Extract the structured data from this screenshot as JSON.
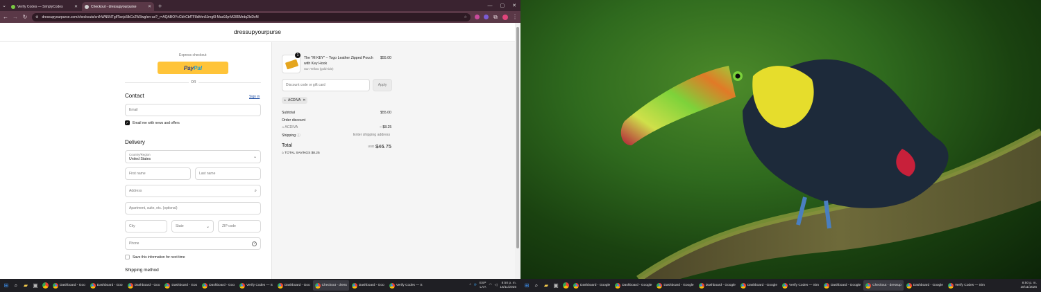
{
  "browser": {
    "tabs": [
      {
        "title": "Verify Codes — SimplyCodes",
        "active": false,
        "favicon_color": "#7ac943"
      },
      {
        "title": "Checkout - dressupyourpurse",
        "active": true,
        "favicon_color": "#cfcfcf"
      }
    ],
    "url": "dressupyourpurse.com/checkouts/cn/hWN5NTgIfTanjc5lkCx2W3wg/en-us?_r=AQABOYcCbhCbfTF8dhhn5Jmg6l-Mus9Jp4A285Mrdq2lxDxM",
    "nav_icons": [
      "back-icon",
      "forward-icon",
      "reload-icon",
      "site-info-icon"
    ]
  },
  "store": {
    "name": "dressupyourpurse"
  },
  "express": {
    "label": "Express checkout",
    "paypal_left": "Pay",
    "paypal_right": "Pal",
    "or_label": "OR"
  },
  "contact": {
    "heading": "Contact",
    "sign_in": "Sign in",
    "email_placeholder": "Email",
    "newsletter_label": "Email me with news and offers",
    "newsletter_checked": true
  },
  "delivery": {
    "heading": "Delivery",
    "country_label": "Country/Region",
    "country_value": "United States",
    "first_name": "First name",
    "last_name": "Last name",
    "address": "Address",
    "apartment": "Apartment, suite, etc. (optional)",
    "city": "City",
    "state": "State",
    "zip": "ZIP code",
    "phone": "Phone",
    "save_info": "Save this information for next time",
    "save_checked": false
  },
  "shipping_method": {
    "heading": "Shipping method"
  },
  "order": {
    "item": {
      "qty": "1",
      "name_line1": "The \"M KEY\" – Togo Leather Zipped Pouch",
      "name_line2": "with Key Hook",
      "variant": "Sun Yellow (gold-tide)",
      "price": "$55.00"
    },
    "discount_placeholder": "Discount code or gift card",
    "apply": "Apply",
    "applied_code": "ACDIVA",
    "subtotal_label": "Subtotal",
    "subtotal_value": "$55.00",
    "order_discount_label": "Order discount",
    "discount_code": "ACDIVA",
    "discount_value": "– $8.25",
    "shipping_label": "Shipping",
    "shipping_value": "Enter shipping address",
    "total_label": "Total",
    "currency": "USD",
    "total_value": "$46.75",
    "savings_label": "TOTAL SAVINGS",
    "savings_value": "$8.25"
  },
  "taskbar_left": {
    "apps": [
      "Dashboard - Goo",
      "Dashboard - Goo",
      "Dashboard - Goo",
      "Dashboard - Goo",
      "Dashboard - Goo",
      "Verify Codes — S",
      "Dashboard - Goo",
      "Checkout - dress",
      "Dashboard - Goo",
      "Verify Codes — S"
    ],
    "selected_index": 7,
    "lang_line1": "ESP",
    "lang_line2": "LAA",
    "time": "8:50 p. m.",
    "date": "18/11/2025"
  },
  "taskbar_right": {
    "apps": [
      "Dashboard - Google",
      "Dashboard - Google",
      "Dashboard - Google",
      "Dashboard - Google",
      "Dashboard - Google",
      "Verify Codes — Sim",
      "Dashboard - Google",
      "Checkout - dressup",
      "Dashboard - Google",
      "Verify Codes — Sim"
    ],
    "selected_index": 7,
    "time": "8:50 p. m.",
    "date": "18/11/2025"
  }
}
